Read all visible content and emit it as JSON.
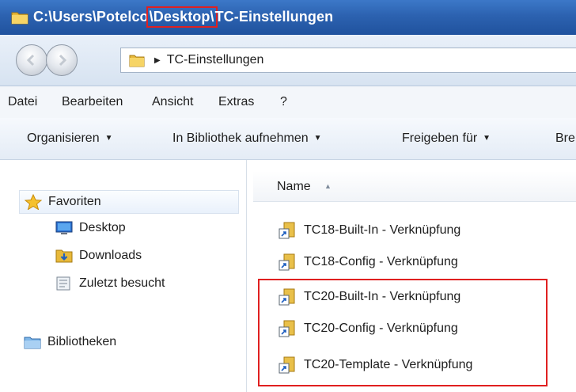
{
  "window": {
    "title_prefix": "C:\\Users\\Potelco",
    "title_highlight": "\\Desktop\\",
    "title_suffix": "TC-Einstellungen"
  },
  "address_bar": {
    "path": "TC-Einstellungen"
  },
  "menu": [
    "Datei",
    "Bearbeiten",
    "Ansicht",
    "Extras",
    "?"
  ],
  "commands": [
    {
      "label": "Organisieren"
    },
    {
      "label": "In Bibliothek aufnehmen"
    },
    {
      "label": "Freigeben für"
    },
    {
      "label": "Bre"
    }
  ],
  "sidebar": {
    "favorites": "Favoriten",
    "items": [
      "Desktop",
      "Downloads",
      "Zuletzt besucht"
    ],
    "libraries": "Bibliotheken"
  },
  "list": {
    "column_name": "Name",
    "files": [
      "TC18-Built-In - Verknüpfung",
      "TC18-Config - Verknüpfung",
      "TC20-Built-In - Verknüpfung",
      "TC20-Config - Verknüpfung",
      "TC20-Template - Verknüpfung"
    ]
  },
  "colors": {
    "title_bar": "#2c62b0",
    "highlight": "#e02020"
  }
}
